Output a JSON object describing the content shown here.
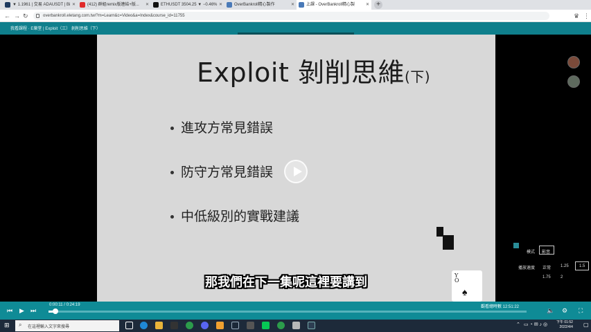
{
  "browser": {
    "tabs": [
      {
        "label": "▼ 1.1961 | 交易 ADAUSDT | Bi",
        "color": "#1e3a5f"
      },
      {
        "label": "(412) 群組remix版連結+版...",
        "color": "#e02b2b"
      },
      {
        "label": "ETHUSDT 3504.25 ▼ −0.46%",
        "color": "#111111"
      },
      {
        "label": "OverBankroll精心製作",
        "color": "#4a7ab8"
      },
      {
        "label": "上課 - OverBankroll精心製",
        "color": "#4a7ab8"
      }
    ],
    "url": "overbankroll.eletang.com.tw/?m=Learn&c=Video&a=Index&course_id=11755"
  },
  "site": {
    "breadcrumb": "我看課程 · E樂堂 | Exploit（三） 剝削思維（下）"
  },
  "slide": {
    "title_main": "Exploit 剝削思維",
    "title_sub": "(下)",
    "bullets": [
      "進攻方常見錯誤",
      "防守方常見錯誤",
      "中低級別的實戰建議"
    ]
  },
  "subtitle": "那我們在下一集呢這裡要講到",
  "card": {
    "rank": "Y\nO",
    "suit": "♠"
  },
  "speed_panel": {
    "mode_label": "模式",
    "mode_value": "影音",
    "speed_label": "播放速度",
    "options": [
      "正常",
      "1.25",
      "1.5",
      "1.75",
      "2"
    ],
    "selected": "1.5"
  },
  "player": {
    "timecode": "0:00:11 / 0:24:19",
    "progress_fraction": 0.008,
    "watch_time": "觀看總時數 12:51:22"
  },
  "taskbar": {
    "search_placeholder": "在這裡輸入文字來搜尋",
    "time": "下午 01:52",
    "date": "2022/4/4"
  }
}
